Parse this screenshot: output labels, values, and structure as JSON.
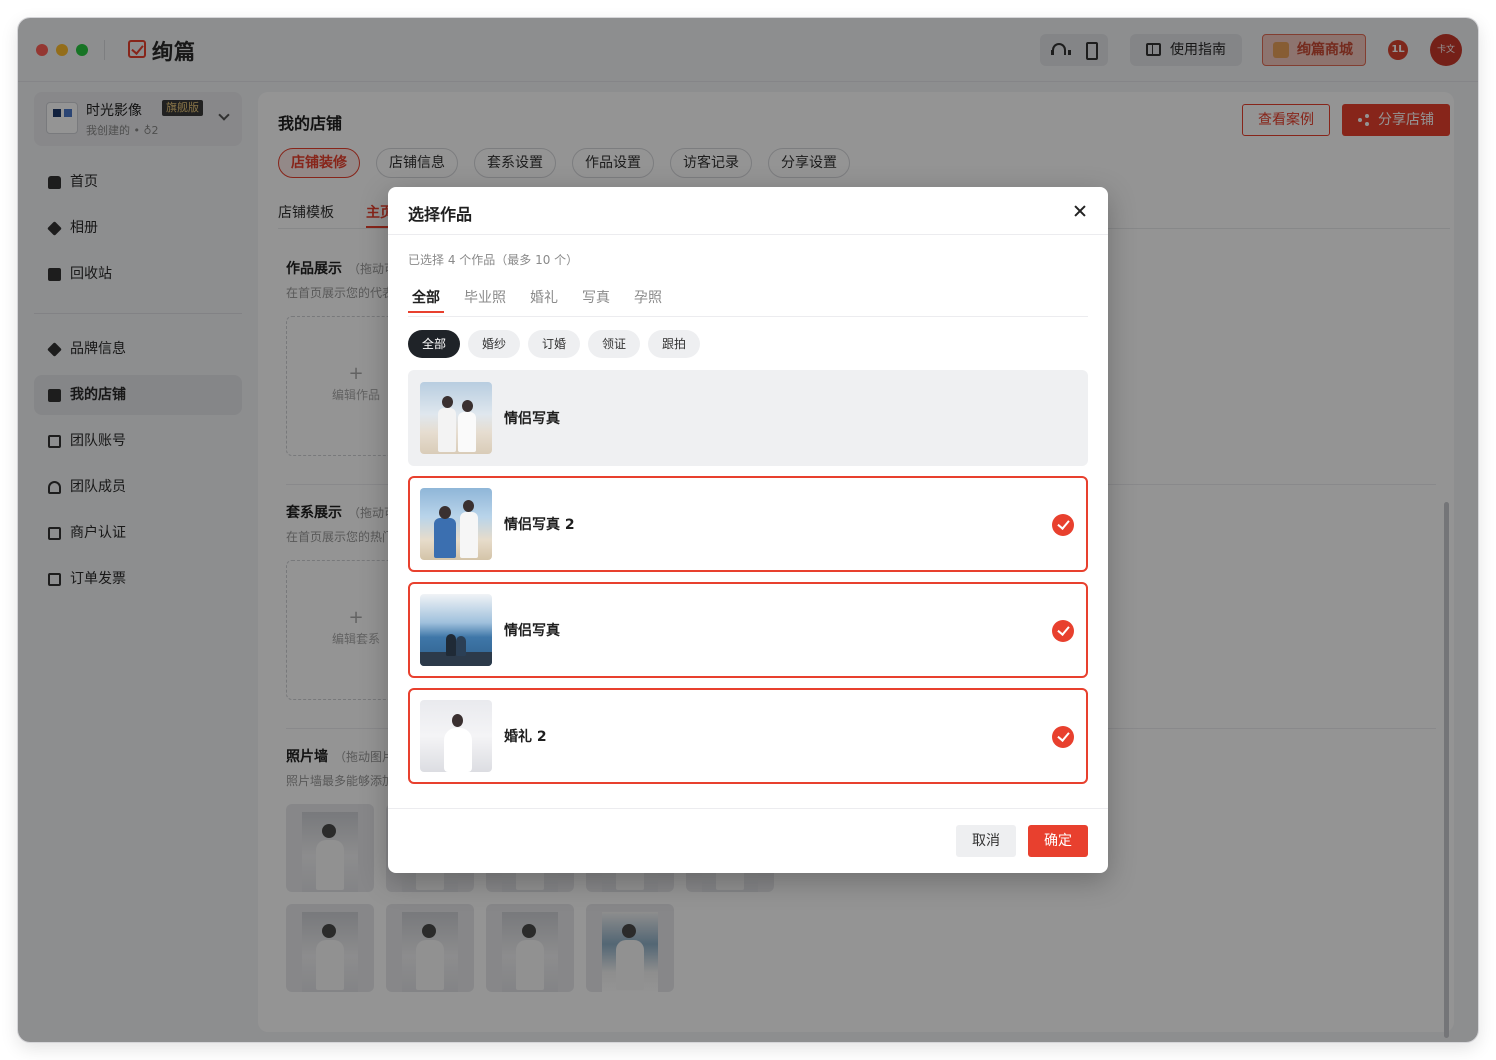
{
  "app": {
    "name": "绚篇",
    "guide_label": "使用指南",
    "mall_label": "绚篇商城",
    "notif_badge": "1L",
    "avatar_text": "卡文"
  },
  "studio": {
    "name": "时光影像",
    "tier": "旗舰版",
    "sub": "我创建的 • ♁2"
  },
  "sidebar": {
    "items": [
      {
        "label": "首页"
      },
      {
        "label": "相册"
      },
      {
        "label": "回收站"
      },
      {
        "label": "品牌信息"
      },
      {
        "label": "我的店铺"
      },
      {
        "label": "团队账号"
      },
      {
        "label": "团队成员"
      },
      {
        "label": "商户认证"
      },
      {
        "label": "订单发票"
      }
    ]
  },
  "main": {
    "title": "我的店铺",
    "view_cases": "查看案例",
    "share_shop": "分享店铺",
    "pills": [
      "店铺装修",
      "店铺信息",
      "套系设置",
      "作品设置",
      "访客记录",
      "分享设置"
    ],
    "subtabs": [
      "店铺模板",
      "主页"
    ],
    "sections": {
      "works": {
        "title": "作品展示",
        "hint": "（拖动可",
        "desc": "在首页展示您的代表",
        "edit": "编辑作品"
      },
      "packages": {
        "title": "套系展示",
        "hint": "（拖动可",
        "desc": "在首页展示您的热门",
        "edit": "编辑套系"
      },
      "wall": {
        "title": "照片墙",
        "hint": "（拖动图片",
        "desc": "照片墙最多能够添加"
      }
    }
  },
  "modal": {
    "title": "选择作品",
    "selected_count": "已选择 4 个作品（最多 10 个）",
    "tabs": [
      "全部",
      "毕业照",
      "婚礼",
      "写真",
      "孕照"
    ],
    "chips": [
      "全部",
      "婚纱",
      "订婚",
      "领证",
      "跟拍"
    ],
    "items": [
      {
        "name": "情侣写真",
        "selected": false
      },
      {
        "name": "情侣写真 2",
        "selected": true
      },
      {
        "name": "情侣写真",
        "selected": true
      },
      {
        "name": "婚礼 2",
        "selected": true
      }
    ],
    "cancel": "取消",
    "confirm": "确定"
  },
  "colors": {
    "accent": "#e8402e",
    "dark_chip": "#1f2328"
  }
}
